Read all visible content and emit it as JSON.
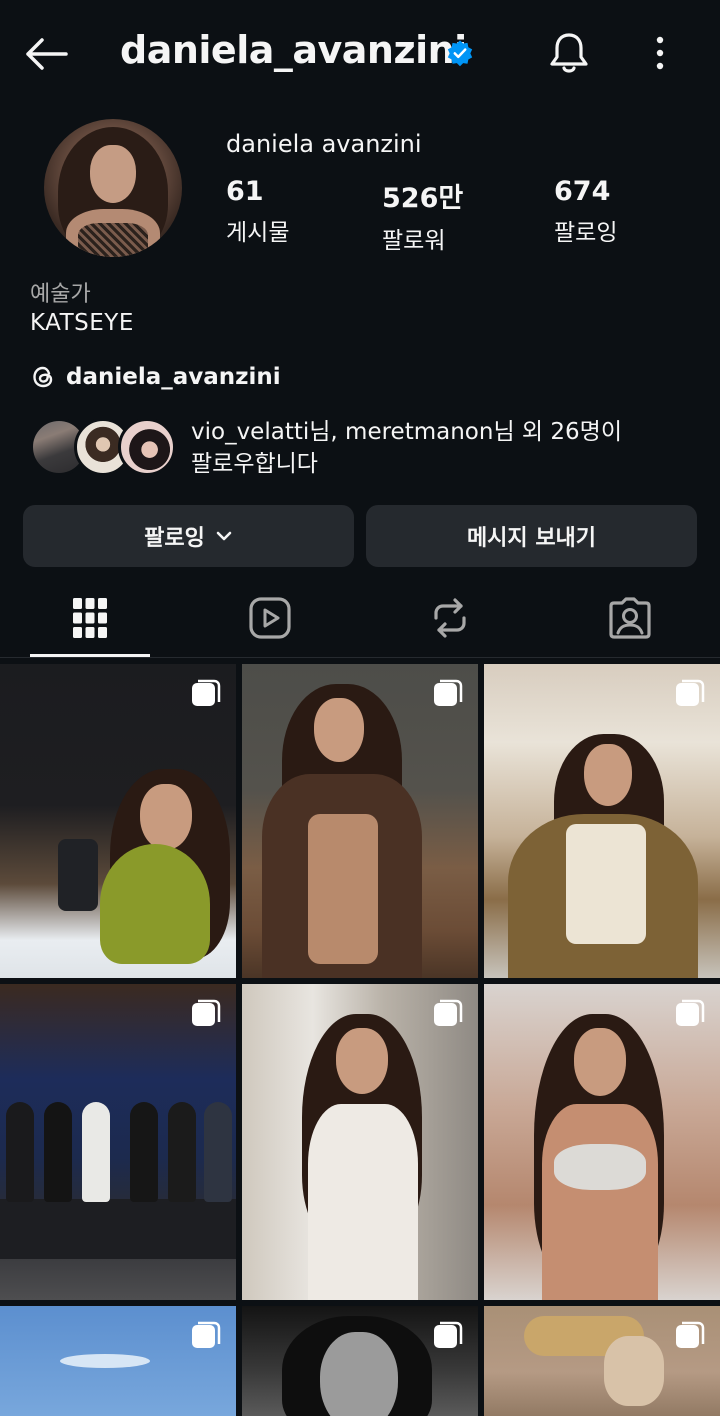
{
  "header": {
    "username": "daniela_avanzini",
    "verified": true,
    "icons": {
      "back": "arrow-left-icon",
      "verified": "verified-badge-icon",
      "notifications": "bell-icon",
      "more": "more-vertical-icon"
    }
  },
  "profile": {
    "display_name": "daniela avanzini",
    "stats": [
      {
        "value": "61",
        "label": "게시물"
      },
      {
        "value": "526만",
        "label": "팔로워"
      },
      {
        "value": "674",
        "label": "팔로잉"
      }
    ],
    "category": "예술가",
    "bio": "KATSEYE",
    "threads_handle": "daniela_avanzini",
    "mutual": {
      "user1": "vio_velatti",
      "suffix1": "님, ",
      "user2": "meretmanon",
      "suffix2": "님 외 26명이",
      "line2": "팔로우합니다"
    }
  },
  "actions": {
    "follow_label": "팔로잉",
    "message_label": "메시지 보내기"
  },
  "tabs": [
    {
      "name": "posts",
      "icon": "grid-icon",
      "active": true
    },
    {
      "name": "reels",
      "icon": "reels-play-icon",
      "active": false
    },
    {
      "name": "reposts",
      "icon": "repost-icon",
      "active": false
    },
    {
      "name": "tagged",
      "icon": "tagged-person-icon",
      "active": false
    }
  ],
  "grid": {
    "item_count": 9,
    "multi_post_icon": "carousel-icon"
  },
  "colors": {
    "background": "#0c1014",
    "text": "#f5f5f5",
    "secondary_text": "#a8a8a8",
    "button_bg": "#25292e",
    "verified_blue": "#0095f6"
  }
}
